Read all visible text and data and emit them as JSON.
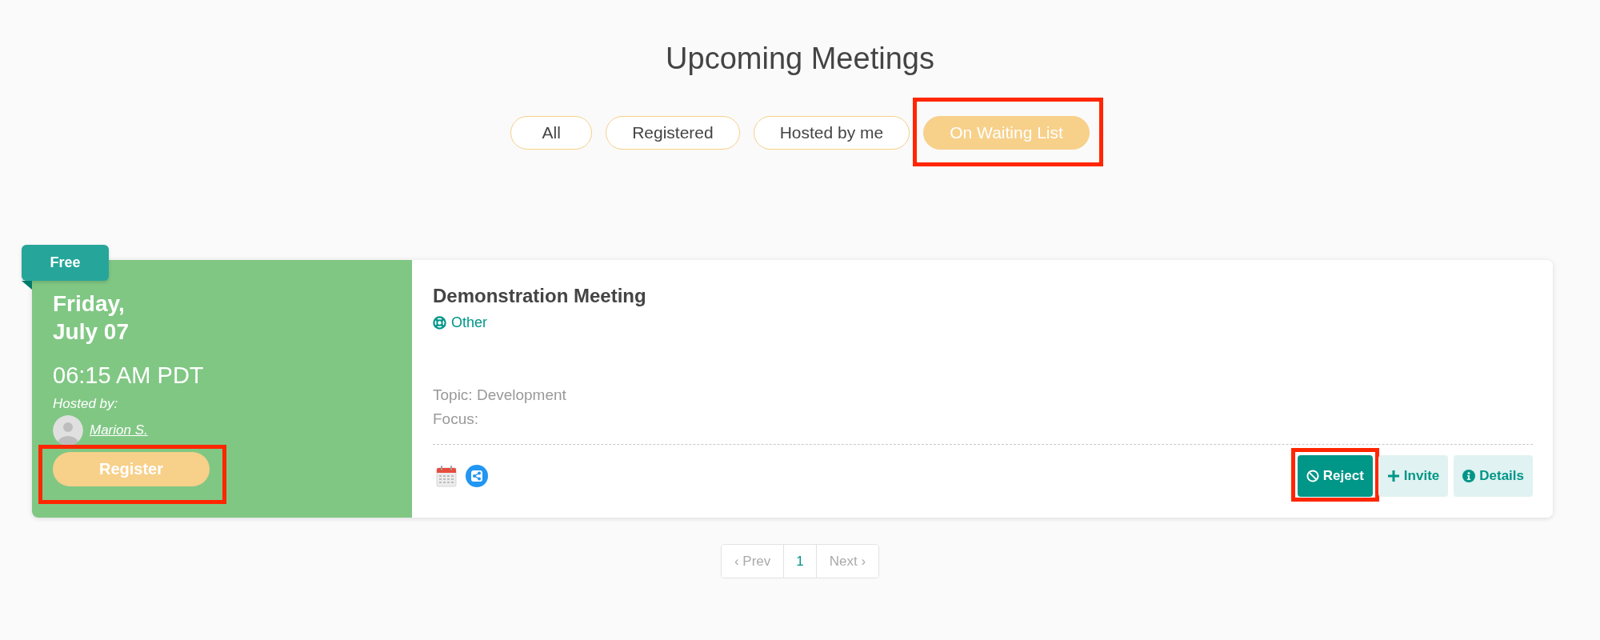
{
  "page": {
    "title": "Upcoming Meetings"
  },
  "filters": [
    {
      "label": "All",
      "selected": false,
      "highlighted": false
    },
    {
      "label": "Registered",
      "selected": false,
      "highlighted": false
    },
    {
      "label": "Hosted by me",
      "selected": false,
      "highlighted": false
    },
    {
      "label": "On Waiting List",
      "selected": true,
      "highlighted": true
    }
  ],
  "meetings": [
    {
      "badge": "Free",
      "day": "Friday,",
      "date": "July 07",
      "time": "06:15 AM PDT",
      "host_label": "Hosted by:",
      "host_name": "Marion S.",
      "register": {
        "label": "Register",
        "highlighted": true
      },
      "title": "Demonstration Meeting",
      "category": "Other",
      "info_lines": [
        "Topic: Development",
        "Focus:"
      ],
      "actions": [
        {
          "label": "Reject",
          "kind": "reject",
          "primary": true,
          "highlighted": true
        },
        {
          "label": "Invite",
          "kind": "invite",
          "primary": false,
          "highlighted": false
        },
        {
          "label": "Details",
          "kind": "details",
          "primary": false,
          "highlighted": false
        }
      ]
    }
  ],
  "pagination": {
    "prev": "‹ Prev",
    "pages": [
      {
        "label": "1",
        "selected": true
      }
    ],
    "next": "Next ›"
  }
}
